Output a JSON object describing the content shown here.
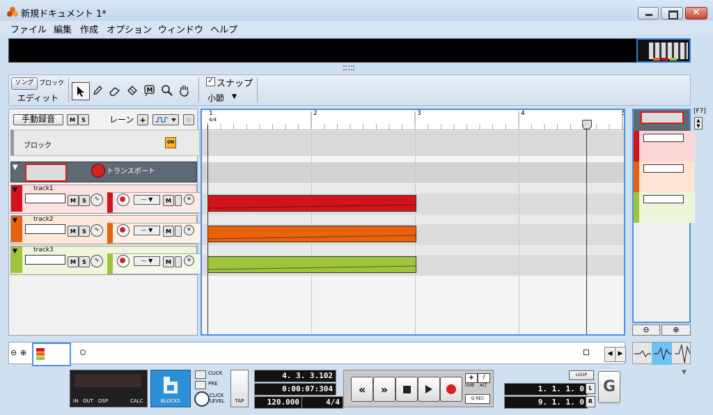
{
  "window": {
    "title": "新規ドキュメント 1*"
  },
  "menu": [
    "ファイル",
    "編集",
    "作成",
    "オプション",
    "ウィンドウ",
    "ヘルプ"
  ],
  "toolbar": {
    "mode_song": "ソング",
    "mode_block": "ブロック",
    "edit_label": "エディット",
    "snap_label": "スナップ",
    "snap_checked": true,
    "snap_value": "小節"
  },
  "left_panel": {
    "manual_record": "手動録音",
    "mute": "M",
    "solo": "S",
    "lane_label": "レーン",
    "block_label": "ブロック",
    "block_on": "ON",
    "transport_label": "トランスポート",
    "tracks": [
      {
        "name": "track1",
        "color": "#d3141d"
      },
      {
        "name": "track2",
        "color": "#e8620e"
      },
      {
        "name": "track3",
        "color": "#9dc43d"
      }
    ]
  },
  "ruler": {
    "bars": [
      "1",
      "2",
      "3",
      "4",
      "5"
    ],
    "time_signature": "4/4"
  },
  "right_panel": {
    "shortcut": "[F7]"
  },
  "transport": {
    "bottom_labels": [
      "IN",
      "OUT",
      "DSP",
      "CALC"
    ],
    "blocks_label": "BLOCKS",
    "click_label": "CLICK",
    "pre_label": "PRE",
    "click_level_label": "CLICK LEVEL",
    "tap_label": "TAP",
    "position": "4.  3.  3.102",
    "time": "0:00:07:304",
    "tempo": "120.000",
    "signature": "4/4",
    "dub_label": "DUB",
    "alt_label": "ALT",
    "qrec_label": "Q REC",
    "loop_label": "LOOP",
    "left_locator": "1.  1.  1.    0",
    "right_locator": "9.  1.  1.    0",
    "l_label": "L",
    "r_label": "R"
  },
  "colors": {
    "accent": "#4a90e2",
    "track1": "#d3141d",
    "track2": "#e8620e",
    "track3": "#9dc43d",
    "transport_lane": "#5d6a75"
  }
}
